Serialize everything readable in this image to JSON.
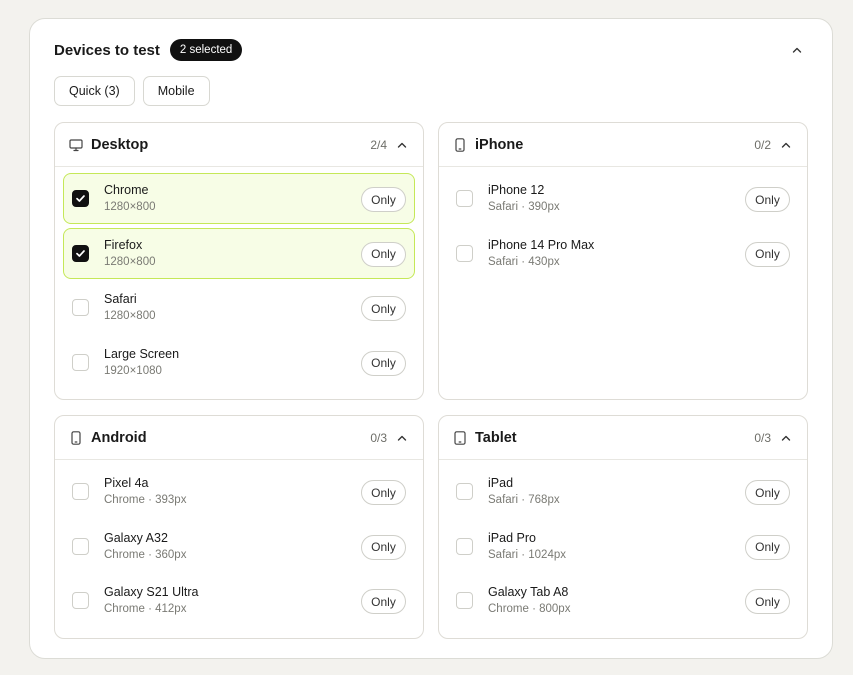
{
  "panel": {
    "title": "Devices to test",
    "selected_badge": "2 selected",
    "presets": [
      "Quick (3)",
      "Mobile"
    ]
  },
  "only_label": "Only",
  "groups": {
    "desktop": {
      "title": "Desktop",
      "count": "2/4",
      "icon": "monitor-icon",
      "items": [
        {
          "name": "Chrome",
          "sub": "1280×800",
          "checked": true
        },
        {
          "name": "Firefox",
          "sub": "1280×800",
          "checked": true
        },
        {
          "name": "Safari",
          "sub": "1280×800",
          "checked": false
        },
        {
          "name": "Large Screen",
          "sub": "1920×1080",
          "checked": false
        }
      ]
    },
    "iphone": {
      "title": "iPhone",
      "count": "0/2",
      "icon": "phone-icon",
      "items": [
        {
          "name": "iPhone 12",
          "sub": "Safari · 390px",
          "checked": false
        },
        {
          "name": "iPhone 14 Pro Max",
          "sub": "Safari · 430px",
          "checked": false
        }
      ]
    },
    "android": {
      "title": "Android",
      "count": "0/3",
      "icon": "phone-icon",
      "items": [
        {
          "name": "Pixel 4a",
          "sub": "Chrome · 393px",
          "checked": false
        },
        {
          "name": "Galaxy A32",
          "sub": "Chrome · 360px",
          "checked": false
        },
        {
          "name": "Galaxy S21 Ultra",
          "sub": "Chrome · 412px",
          "checked": false
        }
      ]
    },
    "tablet": {
      "title": "Tablet",
      "count": "0/3",
      "icon": "tablet-icon",
      "items": [
        {
          "name": "iPad",
          "sub": "Safari · 768px",
          "checked": false
        },
        {
          "name": "iPad Pro",
          "sub": "Safari · 1024px",
          "checked": false
        },
        {
          "name": "Galaxy Tab A8",
          "sub": "Chrome · 800px",
          "checked": false
        }
      ]
    }
  },
  "colors": {
    "selected_bg": "#f7fde6",
    "selected_border": "#c5e858",
    "badge_bg": "#111111",
    "page_bg": "#f3f2ee"
  }
}
